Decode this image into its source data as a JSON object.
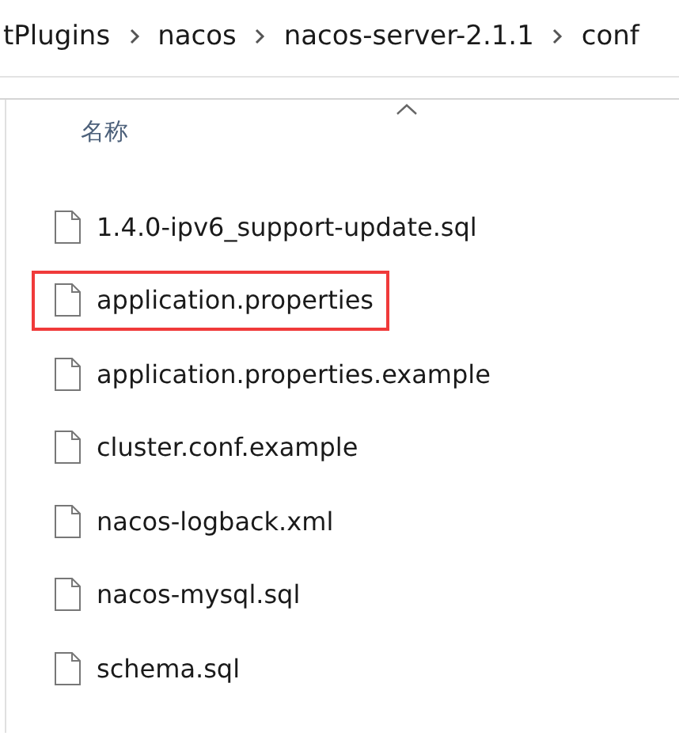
{
  "breadcrumb": [
    "tPlugins",
    "nacos",
    "nacos-server-2.1.1",
    "conf"
  ],
  "column_header": {
    "label": "名称",
    "sorted": true
  },
  "files": [
    {
      "name": "1.4.0-ipv6_support-update.sql",
      "highlighted": false
    },
    {
      "name": "application.properties",
      "highlighted": true
    },
    {
      "name": "application.properties.example",
      "highlighted": false
    },
    {
      "name": "cluster.conf.example",
      "highlighted": false
    },
    {
      "name": "nacos-logback.xml",
      "highlighted": false
    },
    {
      "name": "nacos-mysql.sql",
      "highlighted": false
    },
    {
      "name": "schema.sql",
      "highlighted": false
    }
  ]
}
